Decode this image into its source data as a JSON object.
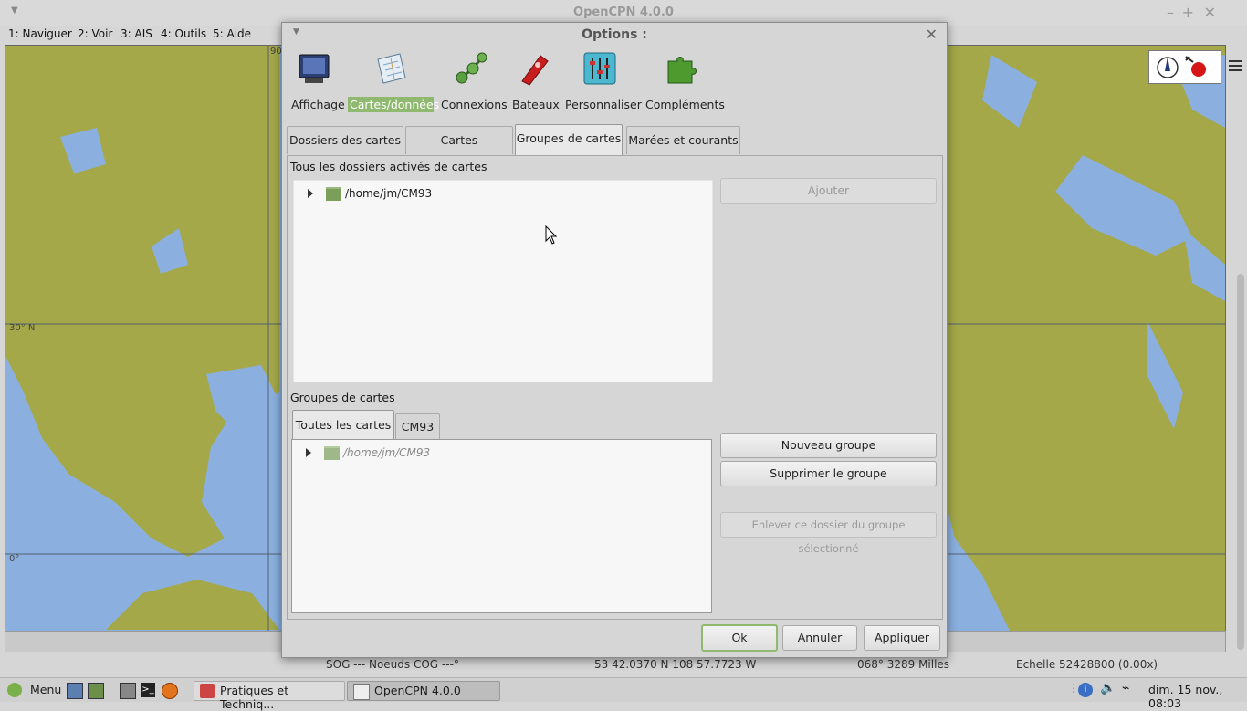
{
  "window": {
    "title": "OpenCPN 4.0.0"
  },
  "menubar": [
    "1: Naviguer",
    "2: Voir",
    "3: AIS",
    "4: Outils",
    "5: Aide"
  ],
  "chart": {
    "lat_labels": [
      "30° N",
      "0°"
    ],
    "top_label": "90°"
  },
  "statusbar": {
    "sog_cog": "SOG --- Noeuds COG ---°",
    "position": "53 42.0370 N   108 57.7723 W",
    "bearing": "068°  3289 Milles",
    "scale": "Echelle 52428800 (0.00x)"
  },
  "dialog": {
    "title": "Options :",
    "categories": [
      {
        "label": "Affichage",
        "icon": "monitor-icon"
      },
      {
        "label": "Cartes/données",
        "icon": "charts-icon"
      },
      {
        "label": "Connexions",
        "icon": "connections-icon"
      },
      {
        "label": "Bateaux",
        "icon": "ship-icon"
      },
      {
        "label": "Personnaliser",
        "icon": "sliders-icon"
      },
      {
        "label": "Compléments",
        "icon": "puzzle-icon"
      }
    ],
    "selected_category": "Cartes/données",
    "tabs": [
      "Dossiers des cartes",
      "Cartes vectorielles",
      "Groupes de cartes",
      "Marées et courants"
    ],
    "active_tab": "Groupes de cartes",
    "all_dirs_label": "Tous les dossiers activés de cartes",
    "all_dirs_tree": [
      "/home/jm/CM93"
    ],
    "add_button": "Ajouter",
    "groups_label": "Groupes de cartes",
    "group_tabs": [
      "Toutes les cartes",
      "CM93"
    ],
    "active_group_tab": "Toutes les cartes",
    "group_tree": [
      "/home/jm/CM93"
    ],
    "new_group_button": "Nouveau groupe",
    "delete_group_button": "Supprimer le groupe",
    "remove_dir_button": "Enlever ce dossier du groupe sélectionné",
    "ok_button": "Ok",
    "cancel_button": "Annuler",
    "apply_button": "Appliquer"
  },
  "taskbar": {
    "menu_label": "Menu",
    "tasks": [
      "Pratiques et Techniq...",
      "OpenCPN 4.0.0"
    ],
    "clock": "dim. 15 nov., 08:03"
  },
  "colors": {
    "land": "#a4a849",
    "water": "#8bb0e0",
    "accent": "#8fb96e"
  }
}
